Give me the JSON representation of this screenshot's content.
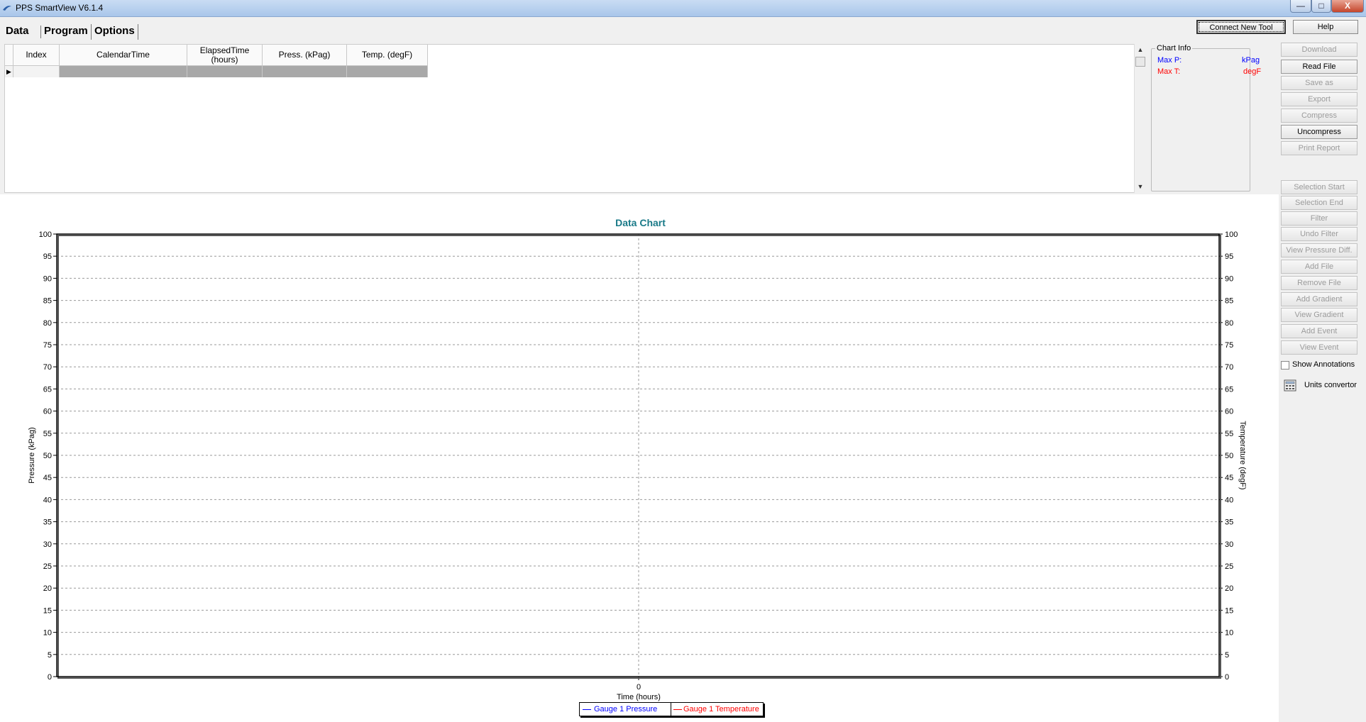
{
  "window": {
    "title": "PPS SmartView V6.1.4",
    "min_glyph": "—",
    "max_glyph": "□",
    "close_glyph": "X"
  },
  "tabs": [
    {
      "label": "Data",
      "active": true
    },
    {
      "label": "Program",
      "active": false
    },
    {
      "label": "Options",
      "active": false
    }
  ],
  "top_buttons": {
    "connect": "Connect New Tool",
    "help": "Help"
  },
  "grid": {
    "columns": [
      "Index",
      "CalendarTime",
      "ElapsedTime (hours)",
      "Press. (kPag)",
      "Temp. (degF)"
    ],
    "row_indicator": "▶"
  },
  "chart_info": {
    "title": "Chart Info",
    "max_p_label": "Max P:",
    "max_p_unit": "kPag",
    "max_t_label": "Max T:",
    "max_t_unit": "degF",
    "p_color": "#0000ff",
    "t_color": "#ff0000"
  },
  "side_buttons": [
    {
      "label": "Download",
      "enabled": false
    },
    {
      "label": "Read File",
      "enabled": true
    },
    {
      "label": "Save as",
      "enabled": false
    },
    {
      "label": "Export",
      "enabled": false
    },
    {
      "label": "Compress",
      "enabled": false
    },
    {
      "label": "Uncompress",
      "enabled": true
    },
    {
      "label": "Print Report",
      "enabled": false
    },
    {
      "label": "Selection Start",
      "enabled": false
    },
    {
      "label": "Selection End",
      "enabled": false
    },
    {
      "label": "Filter",
      "enabled": false
    },
    {
      "label": "Undo Filter",
      "enabled": false
    },
    {
      "label": "View Pressure Diff.",
      "enabled": false
    },
    {
      "label": "Add File",
      "enabled": false
    },
    {
      "label": "Remove File",
      "enabled": false
    },
    {
      "label": "Add Gradient",
      "enabled": false
    },
    {
      "label": "View Gradient",
      "enabled": false
    },
    {
      "label": "Add Event",
      "enabled": false
    },
    {
      "label": "View Event",
      "enabled": false
    }
  ],
  "show_annotations": {
    "label": "Show Annotations",
    "checked": false
  },
  "units_convertor": {
    "label": "Units convertor",
    "icon": "calculator-icon"
  },
  "chart_data": {
    "type": "line",
    "title": "Data Chart",
    "xlabel": "Time (hours)",
    "ylabel": "Pressure (kPag)",
    "y2label": "Temperature (degF)",
    "x_ticks": [
      0
    ],
    "ylim": [
      0,
      100
    ],
    "y2lim": [
      0,
      100
    ],
    "y_ticks": [
      0,
      5,
      10,
      15,
      20,
      25,
      30,
      35,
      40,
      45,
      50,
      55,
      60,
      65,
      70,
      75,
      80,
      85,
      90,
      95,
      100
    ],
    "grid": true,
    "legend_position": "bottom-center",
    "series": [
      {
        "name": "Gauge 1 Pressure",
        "color": "#0000ff",
        "values": []
      },
      {
        "name": "Gauge 1 Temperature",
        "color": "#ff0000",
        "values": []
      }
    ]
  }
}
